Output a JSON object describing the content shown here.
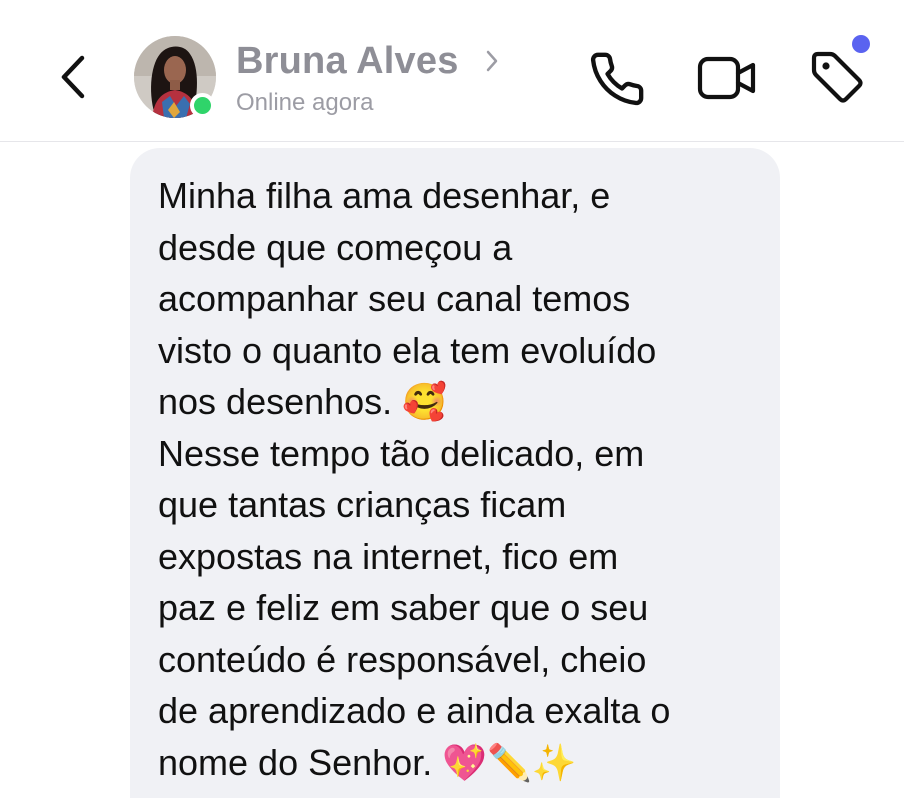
{
  "header": {
    "back_icon": "chevron-left-icon",
    "contact": {
      "name": "Bruna Alves",
      "status": "Online agora",
      "online": true
    },
    "actions": {
      "phone_icon": "phone-icon",
      "video_icon": "video-camera-icon",
      "tag_icon": "tag-icon",
      "tag_has_notification": true
    }
  },
  "message": {
    "from": "contact",
    "text": "Minha filha ama desenhar, e\ndesde que começou a\nacompanhar seu canal temos\nvisto o quanto ela tem evoluído\nnos desenhos. 🥰\nNesse tempo tão delicado, em\nque tantas crianças ficam\nexpostas na internet, fico em\npaz e feliz em saber que o seu\nconteúdo é responsável, cheio\nde aprendizado e ainda exalta o\nnome do Senhor. 💖✏️✨"
  },
  "colors": {
    "background": "#ffffff",
    "header_divider": "#e6e6ea",
    "contact_name": "#8e8e96",
    "contact_status": "#9c9ca4",
    "online_indicator": "#2fd46a",
    "notification_dot": "#5a63f0",
    "bubble_background": "#f0f1f5",
    "message_text": "#111111",
    "icon_stroke": "#111111"
  }
}
